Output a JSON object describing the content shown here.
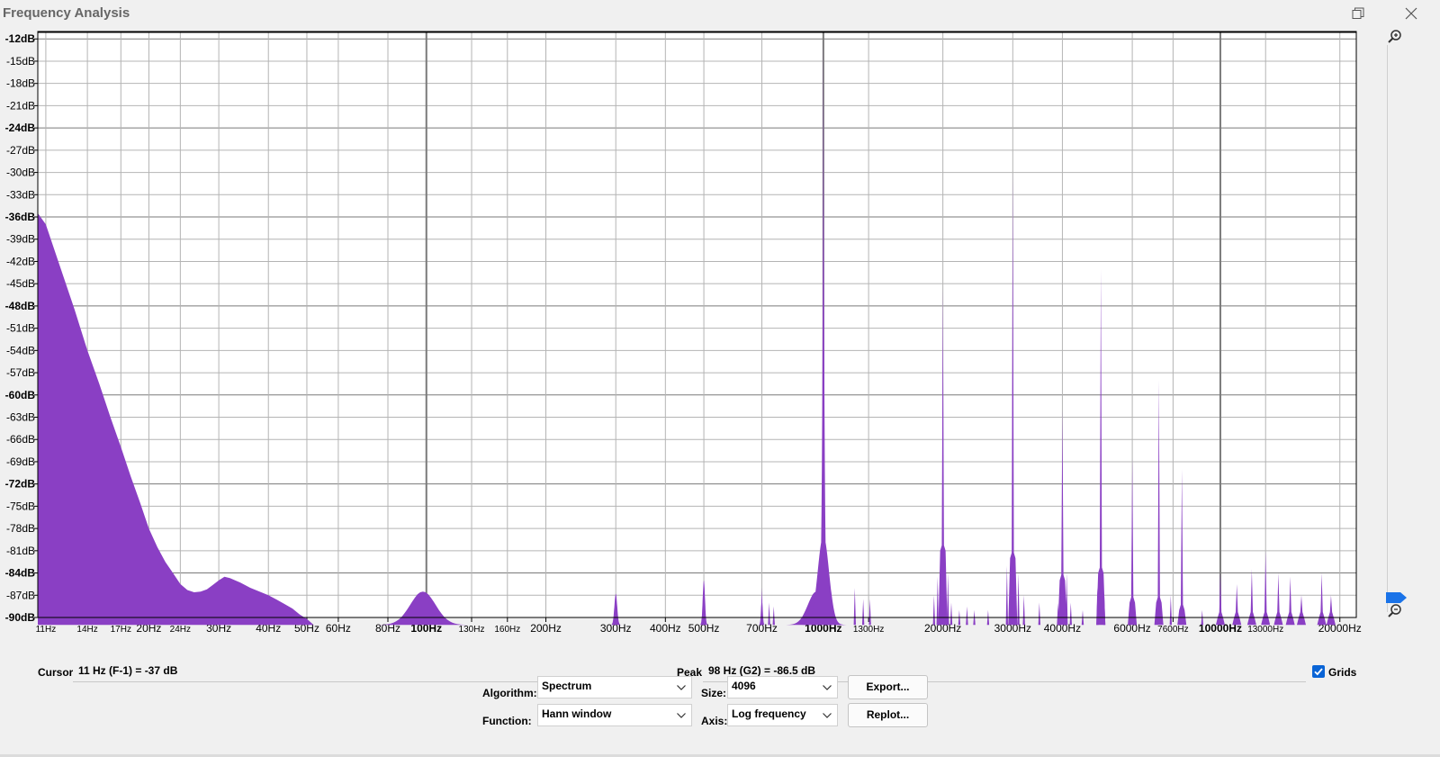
{
  "window": {
    "title": "Frequency Analysis"
  },
  "chart_data": {
    "type": "area",
    "title": "",
    "xlabel": "",
    "ylabel": "",
    "xscale": "log",
    "xlim": [
      10.5,
      22000
    ],
    "ylim": [
      -90,
      -11
    ],
    "grid": true,
    "fill_color": "#8a3fc4",
    "y_ticks": [
      "-12dB",
      "-15dB",
      "-18dB",
      "-21dB",
      "-24dB",
      "-27dB",
      "-30dB",
      "-33dB",
      "-36dB",
      "-39dB",
      "-42dB",
      "-45dB",
      "-48dB",
      "-51dB",
      "-54dB",
      "-57dB",
      "-60dB",
      "-63dB",
      "-66dB",
      "-69dB",
      "-72dB",
      "-75dB",
      "-78dB",
      "-81dB",
      "-84dB",
      "-87dB",
      "-90dB"
    ],
    "x_ticks": [
      {
        "f": 11,
        "label": "11Hz",
        "minor": true
      },
      {
        "f": 14,
        "label": "14Hz",
        "minor": true
      },
      {
        "f": 17,
        "label": "17Hz",
        "minor": true
      },
      {
        "f": 20,
        "label": "20Hz",
        "minor": false
      },
      {
        "f": 24,
        "label": "24Hz",
        "minor": true
      },
      {
        "f": 30,
        "label": "30Hz",
        "minor": false
      },
      {
        "f": 40,
        "label": "40Hz",
        "minor": false
      },
      {
        "f": 50,
        "label": "50Hz",
        "minor": false
      },
      {
        "f": 60,
        "label": "60Hz",
        "minor": false
      },
      {
        "f": 80,
        "label": "80Hz",
        "minor": false
      },
      {
        "f": 100,
        "label": "100Hz",
        "major": true
      },
      {
        "f": 130,
        "label": "130Hz",
        "minor": true
      },
      {
        "f": 160,
        "label": "160Hz",
        "minor": true
      },
      {
        "f": 200,
        "label": "200Hz",
        "minor": false
      },
      {
        "f": 300,
        "label": "300Hz",
        "minor": false
      },
      {
        "f": 400,
        "label": "400Hz",
        "minor": false
      },
      {
        "f": 500,
        "label": "500Hz",
        "minor": false
      },
      {
        "f": 700,
        "label": "700Hz",
        "minor": false
      },
      {
        "f": 1000,
        "label": "1000Hz",
        "major": true
      },
      {
        "f": 1300,
        "label": "1300Hz",
        "minor": true
      },
      {
        "f": 2000,
        "label": "2000Hz",
        "minor": false
      },
      {
        "f": 3000,
        "label": "3000Hz",
        "minor": false
      },
      {
        "f": 4000,
        "label": "4000Hz",
        "minor": false
      },
      {
        "f": 6000,
        "label": "6000Hz",
        "minor": false
      },
      {
        "f": 7600,
        "label": "7600Hz",
        "minor": true
      },
      {
        "f": 10000,
        "label": "10000Hz",
        "major": true
      },
      {
        "f": 13000,
        "label": "13000Hz",
        "minor": true
      },
      {
        "f": 20000,
        "label": "20000Hz",
        "minor": false
      }
    ],
    "floor_db": -91,
    "low_curve": [
      [
        10.5,
        -35.5
      ],
      [
        11,
        -37
      ],
      [
        12,
        -43
      ],
      [
        13,
        -48.5
      ],
      [
        14,
        -54
      ],
      [
        15,
        -58.5
      ],
      [
        16,
        -63
      ],
      [
        17,
        -67
      ],
      [
        18,
        -71
      ],
      [
        19,
        -74.5
      ],
      [
        20,
        -78
      ],
      [
        21,
        -80.5
      ],
      [
        22,
        -82.5
      ],
      [
        23,
        -84
      ],
      [
        24,
        -85.5
      ],
      [
        25,
        -86.3
      ],
      [
        26,
        -86.6
      ],
      [
        27,
        -86.5
      ],
      [
        28,
        -86.2
      ],
      [
        29,
        -85.6
      ],
      [
        30,
        -85
      ],
      [
        31,
        -84.5
      ],
      [
        32,
        -84.7
      ],
      [
        34,
        -85.3
      ],
      [
        36,
        -86
      ],
      [
        38,
        -86.5
      ],
      [
        40,
        -87
      ],
      [
        42,
        -87.6
      ],
      [
        44,
        -88.2
      ],
      [
        46,
        -88.8
      ],
      [
        48,
        -89.6
      ],
      [
        50,
        -90.2
      ],
      [
        52,
        -91
      ]
    ],
    "bumps": [
      {
        "f": 98,
        "peak": -86.5,
        "width": 0.045
      },
      {
        "f": 300,
        "peak": -86.8,
        "width": 0.005
      },
      {
        "f": 500,
        "peak": -85,
        "width": 0.004
      },
      {
        "f": 700,
        "peak": -87.5,
        "width": 0.003
      },
      {
        "f": 960,
        "peak": -86.5,
        "width": 0.03
      }
    ],
    "main_peak": {
      "f": 1000,
      "peak": -12,
      "skirt_db": -88
    },
    "harmonics": [
      {
        "f": 2000,
        "peak": -45.5,
        "skirt": -81
      },
      {
        "f": 3000,
        "peak": -30,
        "skirt": -82
      },
      {
        "f": 4000,
        "peak": -62,
        "skirt": -85
      },
      {
        "f": 5000,
        "peak": -43,
        "skirt": -84
      },
      {
        "f": 6000,
        "peak": -68.5,
        "skirt": -88
      },
      {
        "f": 7000,
        "peak": -58,
        "skirt": -88
      },
      {
        "f": 8000,
        "peak": -70,
        "skirt": -89
      },
      {
        "f": 10000,
        "peak": -84,
        "skirt": -90
      },
      {
        "f": 11000,
        "peak": -85.5,
        "skirt": -90
      },
      {
        "f": 12000,
        "peak": -83.5,
        "skirt": -90
      },
      {
        "f": 13000,
        "peak": -81,
        "skirt": -90
      },
      {
        "f": 14000,
        "peak": -84,
        "skirt": -90
      },
      {
        "f": 15000,
        "peak": -84.5,
        "skirt": -90
      },
      {
        "f": 16000,
        "peak": -87,
        "skirt": -90
      },
      {
        "f": 18000,
        "peak": -84,
        "skirt": -90
      },
      {
        "f": 19000,
        "peak": -87,
        "skirt": -90
      }
    ],
    "spurs": [
      {
        "f": 700,
        "peak": -86
      },
      {
        "f": 730,
        "peak": -88
      },
      {
        "f": 750,
        "peak": -88.5
      },
      {
        "f": 1200,
        "peak": -86
      },
      {
        "f": 1260,
        "peak": -87.5
      },
      {
        "f": 1310,
        "peak": -87.5
      },
      {
        "f": 1900,
        "peak": -87
      },
      {
        "f": 1940,
        "peak": -84.5
      },
      {
        "f": 2060,
        "peak": -84
      },
      {
        "f": 2100,
        "peak": -88
      },
      {
        "f": 2200,
        "peak": -89
      },
      {
        "f": 2300,
        "peak": -88.5
      },
      {
        "f": 2400,
        "peak": -89
      },
      {
        "f": 2600,
        "peak": -89
      },
      {
        "f": 2900,
        "peak": -83
      },
      {
        "f": 3100,
        "peak": -84
      },
      {
        "f": 3200,
        "peak": -87
      },
      {
        "f": 3500,
        "peak": -88
      },
      {
        "f": 3900,
        "peak": -88
      },
      {
        "f": 4100,
        "peak": -84
      },
      {
        "f": 4200,
        "peak": -88
      },
      {
        "f": 4500,
        "peak": -89
      },
      {
        "f": 4900,
        "peak": -86
      },
      {
        "f": 5100,
        "peak": -87
      },
      {
        "f": 7500,
        "peak": -87
      },
      {
        "f": 9000,
        "peak": -89
      }
    ]
  },
  "info": {
    "cursor_label": "Cursor:",
    "cursor_value": "11 Hz (F-1) = -37 dB",
    "peak_label": "Peak:",
    "peak_value": "98 Hz (G2) = -86.5 dB",
    "grids_label": "Grids",
    "grids_checked": true
  },
  "controls": {
    "algorithm_label": "Algorithm:",
    "algorithm_value": "Spectrum",
    "size_label": "Size:",
    "size_value": "4096",
    "export_label": "Export...",
    "function_label": "Function:",
    "function_value": "Hann window",
    "axis_label": "Axis:",
    "axis_value": "Log frequency",
    "replot_label": "Replot..."
  }
}
